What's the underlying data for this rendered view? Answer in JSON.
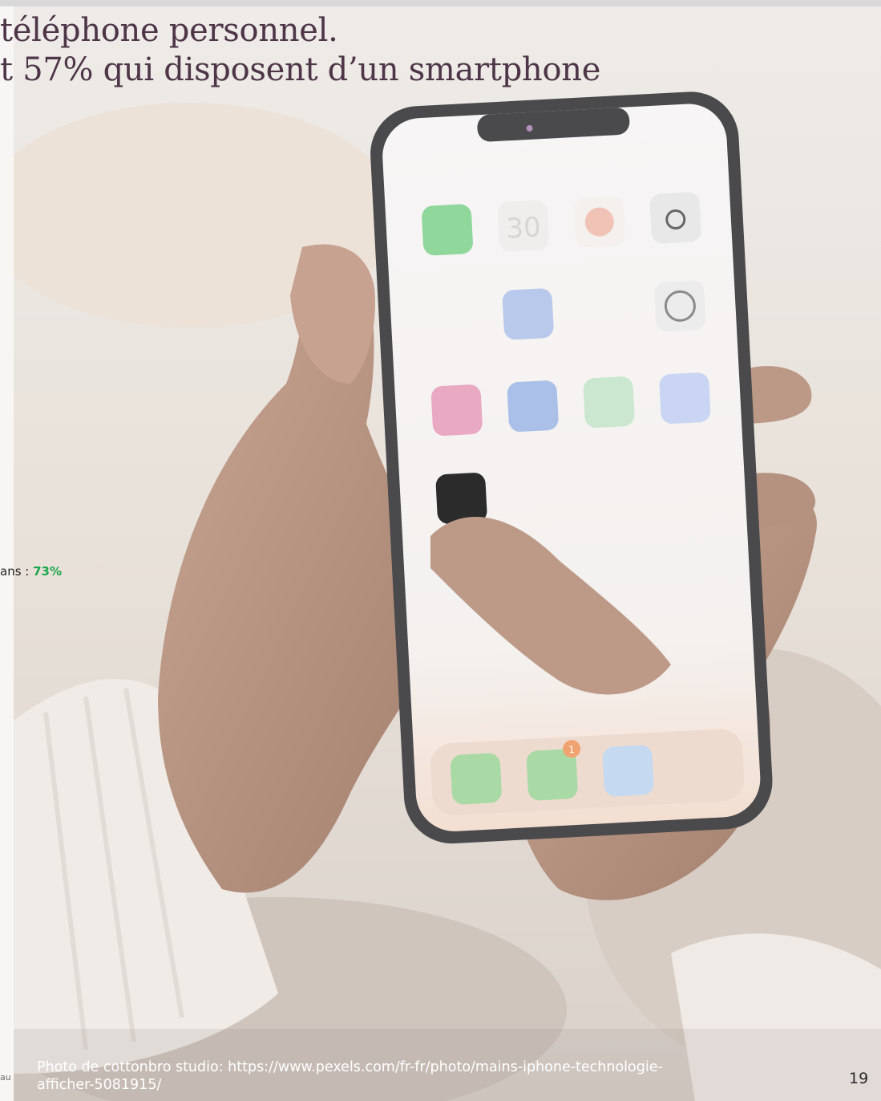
{
  "headline": {
    "line1": "téléphone personnel.",
    "line2": "t 57% qui disposent d’un smartphone"
  },
  "stat": {
    "prefix": "ans : ",
    "value": "73%",
    "value_color": "#1aa64a"
  },
  "photo": {
    "credit": "Photo de cottonbro studio: https://www.pexels.com/fr-fr/photo/mains-iphone-technologie-afficher-5081915/",
    "phone_screen": {
      "clock": "30",
      "message_badge": "1"
    }
  },
  "footer": {
    "left_cut": "au",
    "page_number": "19"
  },
  "colors": {
    "headline": "#4e3548",
    "background": "#f7f6f4"
  }
}
